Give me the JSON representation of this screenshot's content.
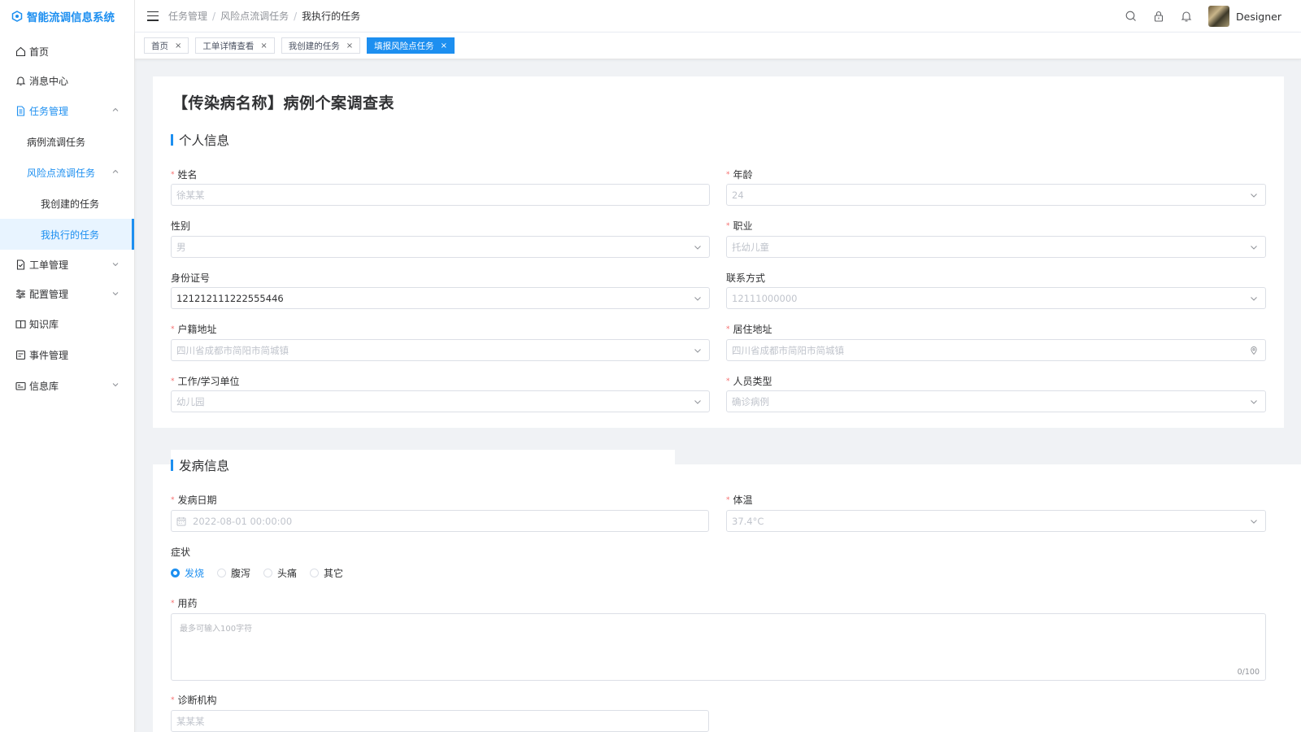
{
  "app": {
    "title": "智能流调信息系统"
  },
  "sidebar": {
    "items": [
      {
        "label": "首页"
      },
      {
        "label": "消息中心"
      },
      {
        "label": "任务管理"
      },
      {
        "label": "病例流调任务"
      },
      {
        "label": "风险点流调任务"
      },
      {
        "label": "我创建的任务"
      },
      {
        "label": "我执行的任务"
      },
      {
        "label": "工单管理"
      },
      {
        "label": "配置管理"
      },
      {
        "label": "知识库"
      },
      {
        "label": "事件管理"
      },
      {
        "label": "信息库"
      }
    ]
  },
  "header": {
    "breadcrumb": [
      "任务管理",
      "风险点流调任务",
      "我执行的任务"
    ],
    "separator": "/",
    "user": "Designer"
  },
  "tabs": [
    {
      "label": "首页"
    },
    {
      "label": "工单详情查看"
    },
    {
      "label": "我创建的任务"
    },
    {
      "label": "填报风险点任务"
    }
  ],
  "tab_close": "×",
  "required_mark": "*",
  "form": {
    "title": "【传染病名称】病例个案调查表",
    "section1": "个人信息",
    "section2": "发病信息",
    "fields": {
      "name": {
        "label": "姓名",
        "placeholder": "徐某某"
      },
      "age": {
        "label": "年龄",
        "value": "24"
      },
      "gender": {
        "label": "性别",
        "value": "男"
      },
      "occupation": {
        "label": "职业",
        "value": "托幼儿童"
      },
      "id_number": {
        "label": "身份证号",
        "value": "121212111222555446"
      },
      "contact": {
        "label": "联系方式",
        "value": "12111000000"
      },
      "household_address": {
        "label": "户籍地址",
        "value": "四川省成都市简阳市简城镇"
      },
      "residence_address": {
        "label": "居住地址",
        "value": "四川省成都市简阳市简城镇"
      },
      "work_unit": {
        "label": "工作/学习单位",
        "value": "幼儿园"
      },
      "person_type": {
        "label": "人员类型",
        "value": "确诊病例"
      },
      "onset_date": {
        "label": "发病日期",
        "value": "2022-08-01 00:00:00"
      },
      "temperature": {
        "label": "体温",
        "value": "37.4°C"
      },
      "symptoms": {
        "label": "症状",
        "options": [
          "发烧",
          "腹泻",
          "头痛",
          "其它"
        ],
        "selected": "发烧"
      },
      "medication": {
        "label": "用药",
        "placeholder": "最多可输入100字符",
        "counter": "0/100"
      },
      "diagnosis_org": {
        "label": "诊断机构",
        "placeholder": "某某某"
      }
    }
  },
  "colors": {
    "accent": "#1d8ff0",
    "required": "#f56c6c"
  }
}
